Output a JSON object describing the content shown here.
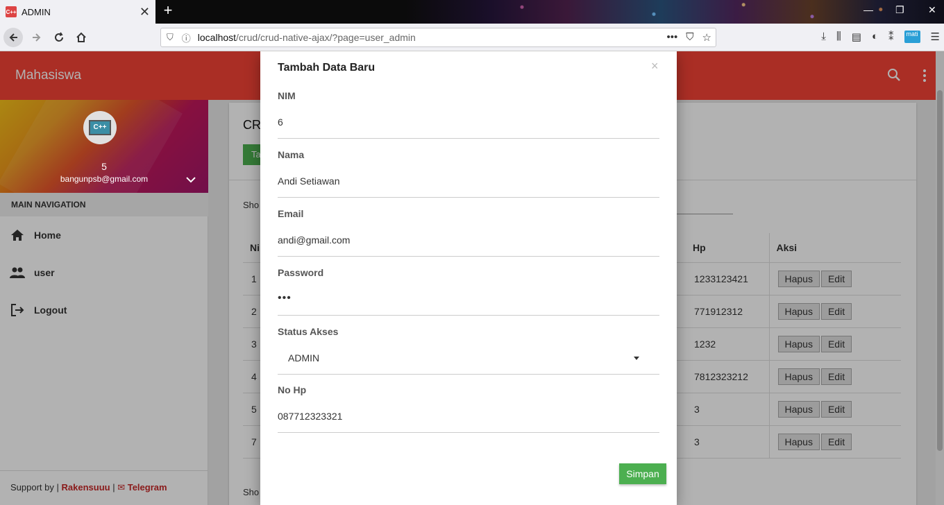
{
  "browser": {
    "tab_title": "ADMIN",
    "favicon_text": "C++",
    "url_host": "localhost",
    "url_path": "/crud/crud-native-ajax/?page=user_admin",
    "new_tab": "+",
    "mati_badge": "mati"
  },
  "app": {
    "brand": "Mahasiswa",
    "accent_color": "#f44336",
    "button_color": "#4caf50"
  },
  "sidebar": {
    "avatar_text": "C++",
    "user_name": "5",
    "user_email": "bangunpsb@gmail.com",
    "nav_header": "MAIN NAVIGATION",
    "items": [
      {
        "label": "Home",
        "icon": "home-icon"
      },
      {
        "label": "user",
        "icon": "people-icon"
      },
      {
        "label": "Logout",
        "icon": "logout-icon"
      }
    ],
    "footer": {
      "prefix": "Support by |",
      "link1": "Rakensuuu",
      "separator": "|",
      "link2": "✉ Telegram"
    }
  },
  "content": {
    "title": "CRU",
    "add_button": "Ta",
    "show_entries": "Sho",
    "show_footer": "Sho",
    "table": {
      "headers": [
        "Ni",
        "Hp",
        "Aksi"
      ],
      "rows": [
        {
          "no": "1",
          "hp": "1233123421"
        },
        {
          "no": "2",
          "hp": "771912312"
        },
        {
          "no": "3",
          "hp": "1232"
        },
        {
          "no": "4",
          "hp": "7812323212"
        },
        {
          "no": "5",
          "hp": "3"
        },
        {
          "no": "7",
          "hp": "3"
        }
      ],
      "delete_label": "Hapus",
      "edit_label": "Edit"
    }
  },
  "modal": {
    "title": "Tambah Data Baru",
    "close": "×",
    "fields": {
      "nim": {
        "label": "NIM",
        "value": "6"
      },
      "nama": {
        "label": "Nama",
        "value": "Andi Setiawan"
      },
      "email": {
        "label": "Email",
        "value": "andi@gmail.com"
      },
      "password": {
        "label": "Password",
        "value": "•••"
      },
      "status": {
        "label": "Status Akses",
        "value": "ADMIN"
      },
      "nohp": {
        "label": "No Hp",
        "value": "087712323321"
      }
    },
    "save_label": "Simpan"
  }
}
